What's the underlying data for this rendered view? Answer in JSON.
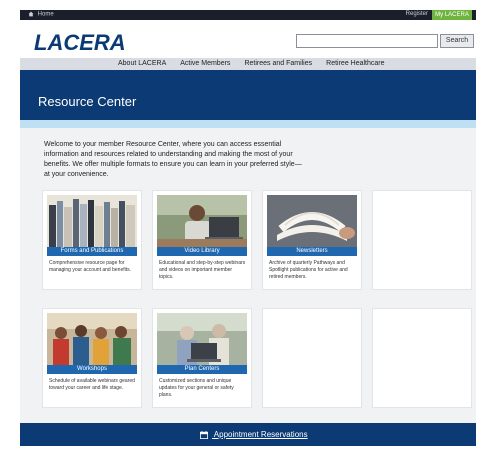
{
  "utility": {
    "home_label": "Home",
    "register_label": "Register",
    "mylacera_label": "My LACERA"
  },
  "header": {
    "logo_text": "LACERA",
    "search_placeholder": "",
    "search_button": "Search"
  },
  "nav": {
    "items": [
      "About LACERA",
      "Active Members",
      "Retirees and Families",
      "Retiree Healthcare"
    ]
  },
  "banner": {
    "title": "Resource Center"
  },
  "intro": {
    "text": "Welcome to your member Resource Center, where you can access essential information and resources related to understanding and making the most of your benefits. We offer multiple formats to ensure you can learn in your preferred style—at your convenience."
  },
  "cards": [
    {
      "label": "Forms and Publications",
      "desc": "Comprehensive resource page for managing your account and benefits."
    },
    {
      "label": "Video Library",
      "desc": "Educational and step-by-step webinars and videos on important member topics."
    },
    {
      "label": "Newsletters",
      "desc": "Archive of quarterly Pathways and Spotlight publications for active and retired members."
    },
    {
      "label": "Workshops",
      "desc": "Schedule of available webinars geared toward your career and life stage."
    },
    {
      "label": "Plan Centers",
      "desc": "Customized sections and unique updates for your general or safety plans."
    }
  ],
  "footer": {
    "link_label": "Appointment Reservations"
  },
  "colors": {
    "navy": "#0b3a74",
    "card_label_blue": "#1f68b0",
    "mylacera_green": "#6fb43f",
    "stripe_light_blue": "#bfe0f2"
  }
}
